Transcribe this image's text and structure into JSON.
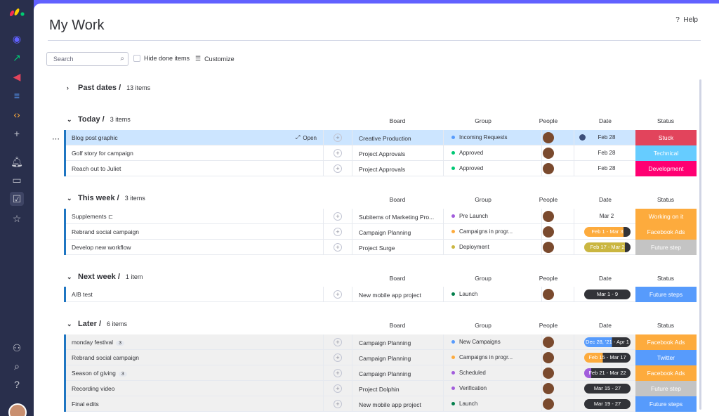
{
  "app": {
    "page_title": "My Work",
    "help_label": "Help"
  },
  "toolbar": {
    "search_placeholder": "Search",
    "hide_done_label": "Hide done items",
    "customize_label": "Customize"
  },
  "columns": {
    "board": "Board",
    "group": "Group",
    "people": "People",
    "date": "Date",
    "status": "Status"
  },
  "row_actions": {
    "open_label": "Open"
  },
  "groups": {
    "past": {
      "title": "Past dates /",
      "count": "13 items"
    },
    "today": {
      "title": "Today /",
      "count": "3 items"
    },
    "week": {
      "title": "This week /",
      "count": "3 items"
    },
    "next": {
      "title": "Next week /",
      "count": "1 item"
    },
    "later": {
      "title": "Later /",
      "count": "6 items"
    }
  },
  "rows": [
    {
      "name": "Blog post graphic",
      "board": "Creative Production",
      "group": "Incoming Requests",
      "group_color": "#579bfc",
      "date": "Feb 28",
      "status": "Stuck",
      "status_color": "#e2445c"
    },
    {
      "name": "Golf story for campaign",
      "board": "Project Approvals",
      "group": "Approved",
      "group_color": "#00c875",
      "date": "Feb 28",
      "status": "Technical",
      "status_color": "#66ccff"
    },
    {
      "name": "Reach out to Juliet",
      "board": "Project Approvals",
      "group": "Approved",
      "group_color": "#00c875",
      "date": "Feb 28",
      "status": "Development",
      "status_color": "#ff0072"
    },
    {
      "name": "Supplements",
      "board": "Subitems of Marketing Pro...",
      "group": "Pre Launch",
      "group_color": "#a25ddc",
      "date": "Mar 2",
      "status": "Working on it",
      "status_color": "#fdab3d"
    },
    {
      "name": "Rebrand social campaign",
      "board": "Campaign Planning",
      "group": "Campaigns in progr...",
      "group_color": "#fdab3d",
      "date": "Feb 1 - Mar 3",
      "date_color": "#fdab3d",
      "status": "Facebook Ads",
      "status_color": "#fdab3d"
    },
    {
      "name": "Develop new workflow",
      "board": "Project Surge",
      "group": "Deployment",
      "group_color": "#cab641",
      "date": "Feb 17 - Mar 2",
      "date_color": "#cab641",
      "status": "Future step",
      "status_color": "#c4c4c4"
    },
    {
      "name": "A/B test",
      "board": "New mobile app project",
      "group": "Launch",
      "group_color": "#037f4c",
      "date": "Mar 1 - 9",
      "date_color": "#323338",
      "status": "Future steps",
      "status_color": "#579bfc"
    },
    {
      "name": "monday festival",
      "badge": "3",
      "board": "Campaign Planning",
      "group": "New Campaigns",
      "group_color": "#579bfc",
      "date": "Dec 28, '21 - Apr 1",
      "date_color": "#579bfc",
      "status": "Facebook Ads",
      "status_color": "#fdab3d"
    },
    {
      "name": "Rebrand social campaign",
      "board": "Campaign Planning",
      "group": "Campaigns in progr...",
      "group_color": "#fdab3d",
      "date": "Feb 15 - Mar 17",
      "date_color": "#fdab3d",
      "status": "Twitter",
      "status_color": "#579bfc"
    },
    {
      "name": "Season of giving",
      "badge": "3",
      "board": "Campaign Planning",
      "group": "Scheduled",
      "group_color": "#a25ddc",
      "date": "Feb 21 - Mar 22",
      "date_color": "#a25ddc",
      "status": "Facebook Ads",
      "status_color": "#fdab3d"
    },
    {
      "name": "Recording video",
      "board": "Project Dolphin",
      "group": "Verification",
      "group_color": "#a25ddc",
      "date": "Mar 15 - 27",
      "date_color": "#323338",
      "status": "Future step",
      "status_color": "#c4c4c4"
    },
    {
      "name": "Final edits",
      "board": "New mobile app project",
      "group": "Launch",
      "group_color": "#037f4c",
      "date": "Mar 19 - 27",
      "date_color": "#323338",
      "status": "Future steps",
      "status_color": "#579bfc"
    }
  ]
}
